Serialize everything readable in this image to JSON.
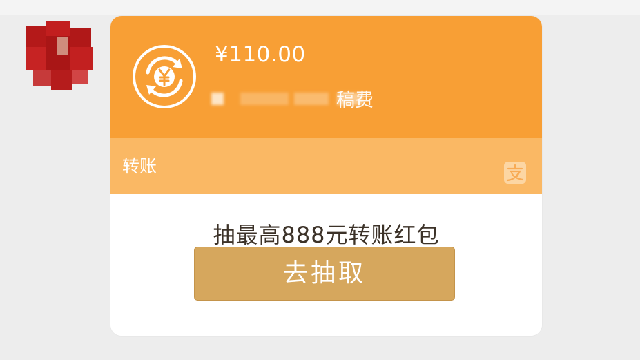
{
  "message": {
    "amount": "¥110.00",
    "remark": "稿费",
    "card_type": "转账"
  },
  "promo": {
    "text": "抽最高888元转账红包",
    "button_label": "去抽取"
  },
  "icons": {
    "amount_icon": "yen-exchange-icon",
    "brand_icon": "alipay-icon",
    "avatar": "pixelated-avatar"
  },
  "colors": {
    "card_header": "#f89f35",
    "card_strip": "#fab864",
    "button": "#d6a75d",
    "promo_text": "#3c3228"
  }
}
